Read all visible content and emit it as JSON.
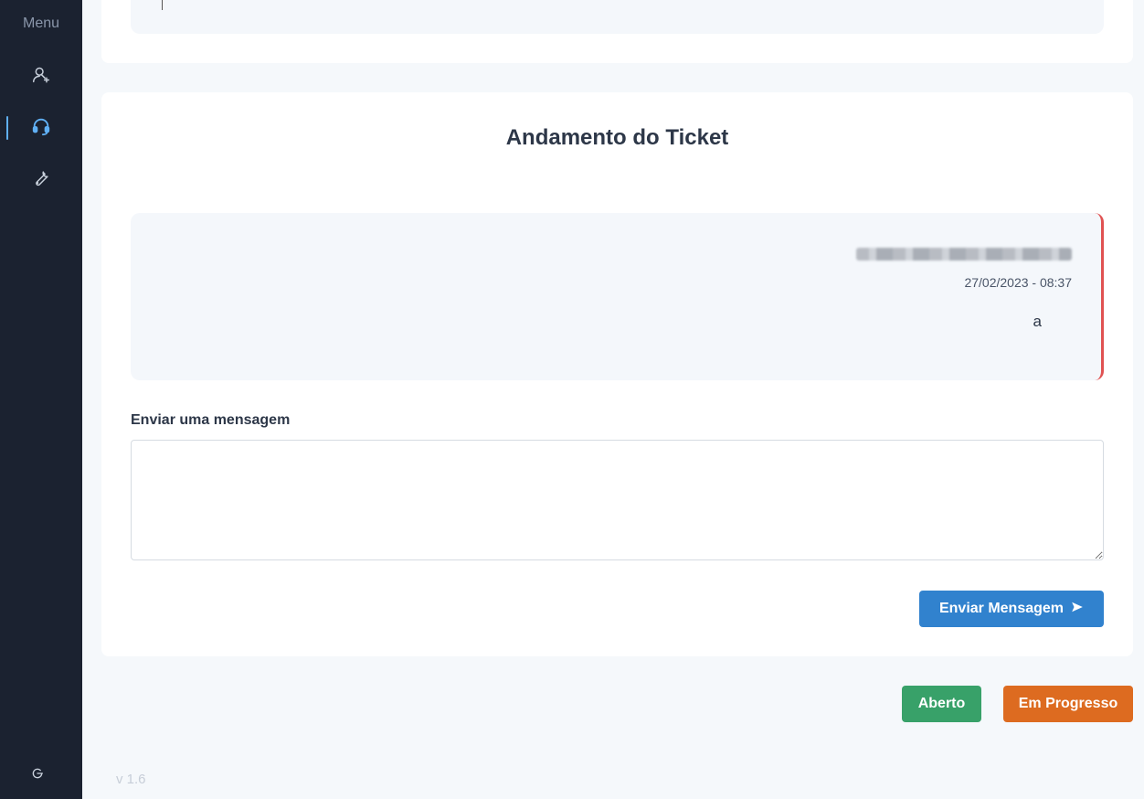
{
  "sidebar": {
    "title": "Menu",
    "items": [
      {
        "icon": "user-plus-icon",
        "active": false
      },
      {
        "icon": "headset-icon",
        "active": true
      },
      {
        "icon": "wrench-icon",
        "active": false
      }
    ],
    "logout_icon": "logout-icon"
  },
  "ticket": {
    "section_title": "Andamento do Ticket",
    "messages": [
      {
        "date": "27/02/2023 - 08:37",
        "text": "a"
      }
    ]
  },
  "form": {
    "label": "Enviar uma mensagem",
    "message_value": "",
    "send_label": "Enviar Mensagem"
  },
  "status_buttons": {
    "open_label": "Aberto",
    "progress_label": "Em Progresso"
  },
  "footer": {
    "version": "v 1.6"
  },
  "colors": {
    "sidebar_bg": "#1b2230",
    "active_accent": "#60b0f4",
    "send_button": "#3182ce",
    "open_button": "#38a169",
    "progress_button": "#dd6b20",
    "message_border": "#e05252"
  }
}
